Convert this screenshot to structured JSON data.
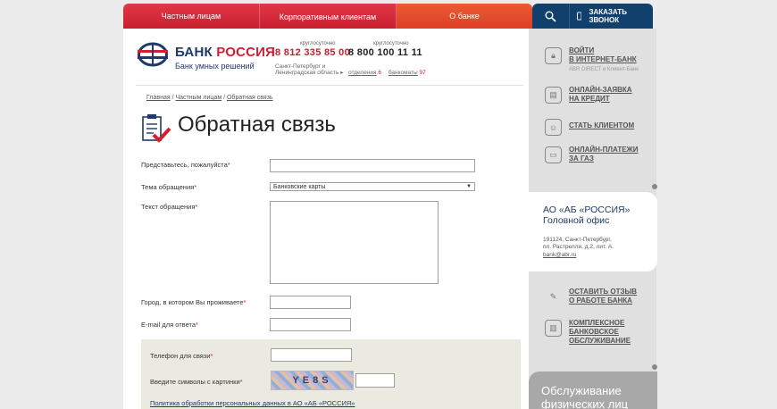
{
  "topnav": {
    "items": [
      "Частным лицам",
      "Корпоративным клиентам",
      "О банке"
    ]
  },
  "rightnav": {
    "callback": "ЗАКАЗАТЬ ЗВОНОК"
  },
  "logo": {
    "title_part1": "БАНК",
    "title_part2": "РОССИЯ",
    "subtitle": "Банк умных решений"
  },
  "phones": {
    "free_label1": "круглосуточно",
    "number1": "8 812 335 85 00",
    "region": "Санкт-Петербург и Ленинградская область ▸",
    "free_label2": "круглосуточно",
    "number2": "8 800 100 11 11",
    "branches_label": "отделения",
    "branches_count": "6",
    "atm_label": "банкоматы",
    "atm_count": "97"
  },
  "breadcrumb": {
    "home": "Главная",
    "private": "Частным лицам",
    "current": "Обратная связь"
  },
  "page_title": "Обратная связь",
  "form": {
    "name_label": "Представьтесь, пожалуйста",
    "topic_label": "Тема обращения",
    "topic_value": "Банковские карты",
    "text_label": "Текст обращения",
    "city_label": "Город, в котором Вы проживаете",
    "email_label": "E-mail для ответа",
    "phone_label": "Телефон для связи",
    "captcha_label": "Введите символы с картинки",
    "captcha_text": "YE8S",
    "policy_link": "Политика обработки персональных данных в АО «АБ «РОССИЯ»"
  },
  "sidebar": {
    "items": [
      {
        "label1": "ВОЙТИ",
        "label2": "В ИНТЕРНЕТ-БАНК",
        "sub": "ABR DIRECT и Клиент-Банк"
      },
      {
        "label1": "ОНЛАЙН-ЗАЯВКА",
        "label2": "НА КРЕДИТ"
      },
      {
        "label1": "СТАТЬ КЛИЕНТОМ"
      },
      {
        "label1": "ОНЛАЙН-ПЛАТЕЖИ",
        "label2": "ЗА ГАЗ"
      },
      {
        "label1": "ОСТАВИТЬ ОТЗЫВ",
        "label2": "О РАБОТЕ БАНКА"
      },
      {
        "label1": "КОМПЛЕКСНОЕ",
        "label2": "БАНКОВСКОЕ",
        "label3": "ОБСЛУЖИВАНИЕ"
      }
    ],
    "office": {
      "title1": "АО «АБ «РОССИЯ»",
      "title2": "Головной офис",
      "addr1": "191124, Санкт-Петербург,",
      "addr2": "пл. Растрелли, д.2, лит. А.",
      "email": "bank@abr.ru"
    },
    "service": {
      "line1": "Обслуживание",
      "line2": "физических лиц"
    }
  }
}
